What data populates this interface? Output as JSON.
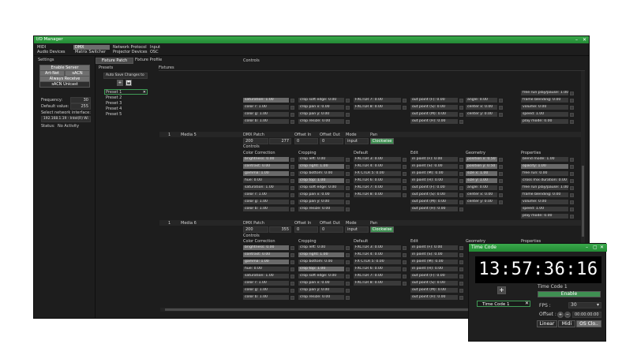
{
  "window": {
    "title": "I/O Manager",
    "minimize_glyph": "–",
    "close_glyph": "✕"
  },
  "menu_row1": [
    "MIDI",
    "DMX",
    "Network Protocol",
    "Input"
  ],
  "menu_row2": [
    "Audio Devices",
    "Matrix Switcher",
    "Projector Devices",
    "OSC"
  ],
  "settings": {
    "header": "Settings",
    "enable_server": "Enable Server",
    "art_net": "Art-Net",
    "sacn": "sACN",
    "always_receive": "Always Receive",
    "sacn_unicast": "sACN Unicast",
    "frequency_label": "Frequency:",
    "frequency_value": "30",
    "default_value_label": "Default value:",
    "default_value_value": "255",
    "network_interface_label": "Select network interface:",
    "network_interface_value": "192.168.1.19 - Intel(R) Wi",
    "status_label": "Status:",
    "status_value": "No Activity"
  },
  "tabs": {
    "fixture_patch": "Fixture Patch",
    "fixture_profile": "Fixture Profile"
  },
  "presets": {
    "header": "Presets",
    "auto_save": "Auto Save Changes to",
    "items": [
      "Preset 1",
      "Preset 2",
      "Preset 3",
      "Preset 4",
      "Preset 5"
    ],
    "selected_close": "✕"
  },
  "fixtures_header": "Fixtures",
  "controls_header": "Controls",
  "top_block": {
    "col1": [
      "saturation: 1.00",
      "color r: 1.00",
      "color g: 1.00",
      "color b: 1.00"
    ],
    "col2": [
      "crop soft edge: 0.00",
      "crop pan x: 0.00",
      "crop pan y: 0.00",
      "crop resize: 0.00"
    ],
    "col3": [
      "FXCTLR 7: 0.00",
      "FXCTLR 8: 0.00"
    ],
    "col4": [
      "out point (F): 0.00",
      "out point (S): 0.00",
      "out point (M): 0.00",
      "out point (H): 0.00"
    ],
    "col5": [
      "angle: 0.00",
      "center x: 0.00",
      "center y: 0.00"
    ],
    "col6": [
      "free run play/pause: 1.00",
      "frame blending: 0.00",
      "volume: 0.00",
      "speed: 1.00",
      "play mode: 0.00"
    ]
  },
  "media5": {
    "index": "1",
    "name": "Media 5",
    "dmx_patch_label": "DMX Patch",
    "offset_in_label": "Offset In",
    "offset_out_label": "Offset Out",
    "mode_label": "Mode",
    "pan_label": "Pan",
    "dmx_start": "200",
    "dmx_end": "277",
    "offset_in": "0",
    "offset_out": "0",
    "mode": "input",
    "pan": "Clockwise",
    "controls_label": "Controls",
    "headers": [
      "Color Correction",
      "Cropping",
      "Default",
      "Edit",
      "Geometry",
      "Properties"
    ],
    "col1": [
      "brightness: 0.00",
      "contrast: 0.00",
      "gamma: 1.00",
      "hue: 0.00",
      "saturation: 1.00",
      "color r: 1.00",
      "color g: 1.00",
      "color b: 1.00"
    ],
    "col2": [
      "crop left: 0.00",
      "crop right: 1.00",
      "crop bottom: 0.00",
      "crop top: 1.00",
      "crop soft edge: 0.00",
      "crop pan x: 0.00",
      "crop pan y: 0.00",
      "crop resize: 0.00"
    ],
    "col3": [
      "FXCTLR 3: 0.00",
      "FXCTLR 4: 0.00",
      "FX CTLR 5: 0.00",
      "FXCTLR 6: 0.00",
      "FXCTLR 7: 0.00",
      "FXCTLR 8: 0.00"
    ],
    "col4": [
      "in point (F): 0.00",
      "in point (S): 0.00",
      "in point (M): 0.00",
      "in point (H): 0.00",
      "out point (F): 0.00",
      "out point (S): 0.00",
      "out point (M): 0.00",
      "out point (H): 0.00"
    ],
    "col5": [
      "position x: 0.50",
      "position y: 0.50",
      "size x: 1.00",
      "size y: 1.00",
      "angle: 0.00",
      "center x: 0.00",
      "center y: 0.00"
    ],
    "col6": [
      "blend mode: 1.00",
      "opacity: 1.00",
      "free run: 0.00",
      "cross mix duration: 0.00",
      "free run play/pause: 1.00",
      "frame blending: 0.00",
      "volume: 0.00",
      "speed: 1.00",
      "play mode: 0.00"
    ]
  },
  "media6": {
    "index": "1",
    "name": "Media 6",
    "dmx_start": "200",
    "dmx_end": "355",
    "offset_in": "0",
    "offset_out": "0",
    "mode": "input",
    "pan": "Clockwise",
    "headers": [
      "Color Correction",
      "Cropping",
      "Default",
      "Edit",
      "Geometry",
      "Properties"
    ],
    "col1": [
      "brightness: 0.00",
      "contrast: 0.00",
      "gamma: 1.00",
      "hue: 0.00",
      "saturation: 1.00",
      "color r: 1.00",
      "color g: 1.00",
      "color b: 1.00"
    ],
    "col2": [
      "crop left: 0.00",
      "crop right: 1.00",
      "crop bottom: 0.00",
      "crop top: 1.00",
      "crop soft edge: 0.00",
      "crop pan x: 0.00",
      "crop pan y: 0.00",
      "crop resize: 0.00"
    ],
    "col3": [
      "FXCTLR 3: 0.00",
      "FXCTLR 4: 0.00",
      "FX CTLR 5: 0.00",
      "FXCTLR 6: 0.00",
      "FXCTLR 7: 0.00",
      "FXCTLR 8: 0.00"
    ],
    "col4": [
      "in point (F): 0.00",
      "in point (S): 0.00",
      "in point (M): 0.00",
      "in point (H): 0.00",
      "out point (F): 0.00",
      "out point (S): 0.00",
      "out point (M): 0.00",
      "out point (H): 0.00"
    ]
  },
  "timecode": {
    "title": "Time Code",
    "display": "13:57:36:16",
    "item": "Time Code 1",
    "name": "Time Code 1",
    "enable": "Enable",
    "fps_label": "FPS :",
    "fps_value": "30",
    "offset_label": "Offset :",
    "offset_plus": "+",
    "offset_minus": "−",
    "offset_value": "00:00:00:00",
    "mode_linear": "Linear",
    "mode_midi": "Midi",
    "mode_os": "OS Clo..",
    "add_glyph": "+",
    "minimize_glyph": "–",
    "restore_glyph": "▢",
    "close_glyph": "✕"
  },
  "colors": {
    "accent_green": "#2e9a40",
    "button_gray": "#6f6f6f",
    "panel_dark": "#1d1d1d"
  }
}
